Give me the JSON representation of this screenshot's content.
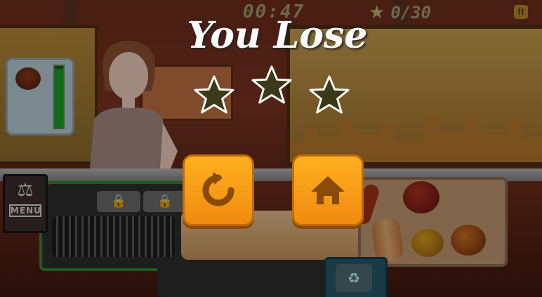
{
  "hud": {
    "timer": "00:47",
    "stars_collected": "0/30",
    "pause_label": "II"
  },
  "result": {
    "title": "You Lose",
    "stars_earned": 0,
    "stars_total": 3
  },
  "buttons": {
    "retry_icon": "restart-icon",
    "home_icon": "home-icon"
  },
  "sidebar": {
    "menu_label": "MENU"
  },
  "order": {
    "item_icon": "burger-icon",
    "patience_fraction": 0.95
  },
  "colors": {
    "button_orange": "#f08a10",
    "patience_green": "#1aa020",
    "grill_rim": "#2a8a2a"
  }
}
